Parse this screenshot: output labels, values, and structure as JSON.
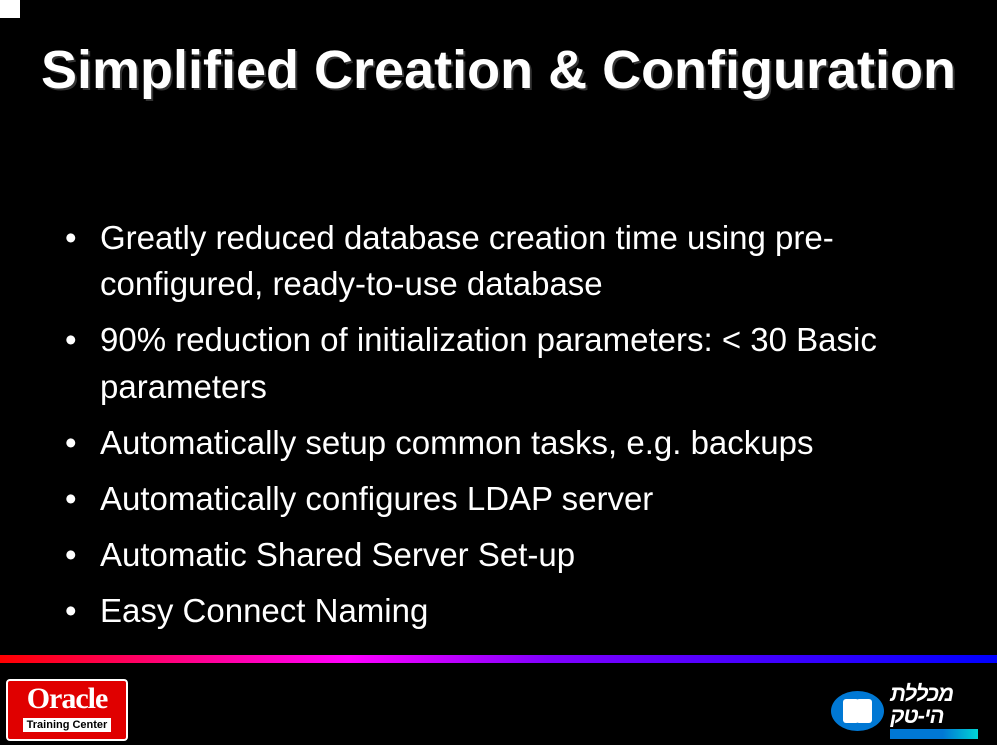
{
  "title": "Simplified Creation & Configuration",
  "bullets": [
    "Greatly reduced database creation time using pre-configured, ready-to-use database",
    "90% reduction of initialization parameters: < 30 Basic parameters",
    "Automatically setup common tasks, e.g. backups",
    "Automatically configures LDAP server",
    "Automatic Shared Server Set-up",
    "Easy Connect Naming"
  ],
  "footer": {
    "oracle_top": "Oracle",
    "oracle_bottom": "Training Center",
    "hitech_text": "מכללת הי-טק"
  }
}
